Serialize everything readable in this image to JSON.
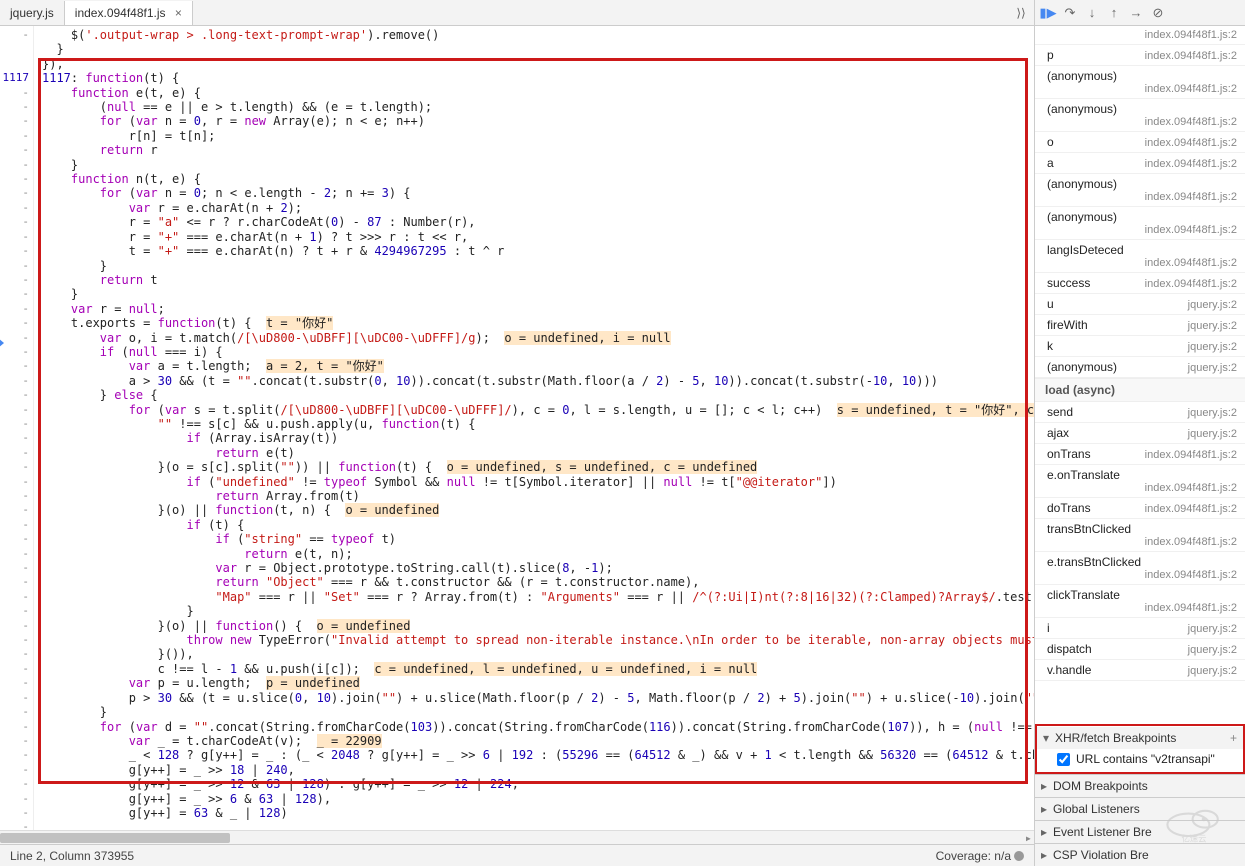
{
  "tabs": {
    "items": [
      "jquery.js",
      "index.094f48f1.js"
    ],
    "active": 1,
    "close_glyph": "×",
    "overflow_glyph": "⟩⟩"
  },
  "gutter": {
    "line_no": "1117",
    "dash": "-",
    "dash_count": 56
  },
  "status": {
    "pos": "Line 2, Column 373955",
    "coverage_label": "Coverage: n/a"
  },
  "debug_toolbar": {
    "resume": "▮▶",
    "step_over": "↷",
    "step_into": "↓",
    "step_out": "↑",
    "step": "→",
    "deactivate": "⊘"
  },
  "callstack": [
    {
      "name": "",
      "loc": "index.094f48f1.js:2",
      "twoline": true
    },
    {
      "name": "p",
      "loc": "index.094f48f1.js:2"
    },
    {
      "name": "(anonymous)",
      "loc": "index.094f48f1.js:2",
      "twoline": true
    },
    {
      "name": "(anonymous)",
      "loc": "index.094f48f1.js:2",
      "twoline": true
    },
    {
      "name": "o",
      "loc": "index.094f48f1.js:2"
    },
    {
      "name": "a",
      "loc": "index.094f48f1.js:2"
    },
    {
      "name": "(anonymous)",
      "loc": "index.094f48f1.js:2",
      "twoline": true
    },
    {
      "name": "(anonymous)",
      "loc": "index.094f48f1.js:2",
      "twoline": true
    },
    {
      "name": "langIsDeteced",
      "loc": "index.094f48f1.js:2",
      "twoline": true
    },
    {
      "name": "success",
      "loc": "index.094f48f1.js:2"
    },
    {
      "name": "u",
      "loc": "jquery.js:2"
    },
    {
      "name": "fireWith",
      "loc": "jquery.js:2"
    },
    {
      "name": "k",
      "loc": "jquery.js:2"
    },
    {
      "name": "(anonymous)",
      "loc": "jquery.js:2"
    },
    {
      "sep": "load (async)"
    },
    {
      "name": "send",
      "loc": "jquery.js:2"
    },
    {
      "name": "ajax",
      "loc": "jquery.js:2"
    },
    {
      "name": "onTrans",
      "loc": "index.094f48f1.js:2"
    },
    {
      "name": "e.onTranslate",
      "loc": "index.094f48f1.js:2",
      "twoline": true
    },
    {
      "name": "doTrans",
      "loc": "index.094f48f1.js:2"
    },
    {
      "name": "transBtnClicked",
      "loc": "index.094f48f1.js:2",
      "twoline": true
    },
    {
      "name": "e.transBtnClicked",
      "loc": "index.094f48f1.js:2",
      "twoline": true
    },
    {
      "name": "clickTranslate",
      "loc": "index.094f48f1.js:2",
      "twoline": true
    },
    {
      "name": "i",
      "loc": "jquery.js:2"
    },
    {
      "name": "dispatch",
      "loc": "jquery.js:2"
    },
    {
      "name": "v.handle",
      "loc": "jquery.js:2"
    }
  ],
  "bp_sections": {
    "xhr": {
      "label": "XHR/fetch Breakpoints",
      "plus": "+",
      "open": true,
      "item_text": "URL contains \"v2transapi\"",
      "checked": true
    },
    "dom": {
      "label": "DOM Breakpoints"
    },
    "global": {
      "label": "Global Listeners"
    },
    "eventlistener": {
      "label": "Event Listener Bre"
    },
    "csp": {
      "label": "CSP Violation Bre"
    }
  },
  "code_inline": {
    "hl_t_nihao": "t = \"你好\"",
    "hl_oi": "o = undefined, i = null",
    "hl_a2": "a = 2, t = \"你好\"",
    "hl_s_undef": "s = undefined, t = \"你好\", c = undefi",
    "hl_osc": "o = undefined, s = undefined, c = undefined",
    "hl_o_undef": "o = undefined",
    "hl_o_undef2": "o = undefined",
    "hl_p_undef": "p = undefined",
    "hl_clui": "c = undefined, l = undefined, u = undefined, i = null",
    "hl_underscore": "_ = 22909",
    "hl_teq": "t = "
  },
  "watermark_text": "亿速云"
}
